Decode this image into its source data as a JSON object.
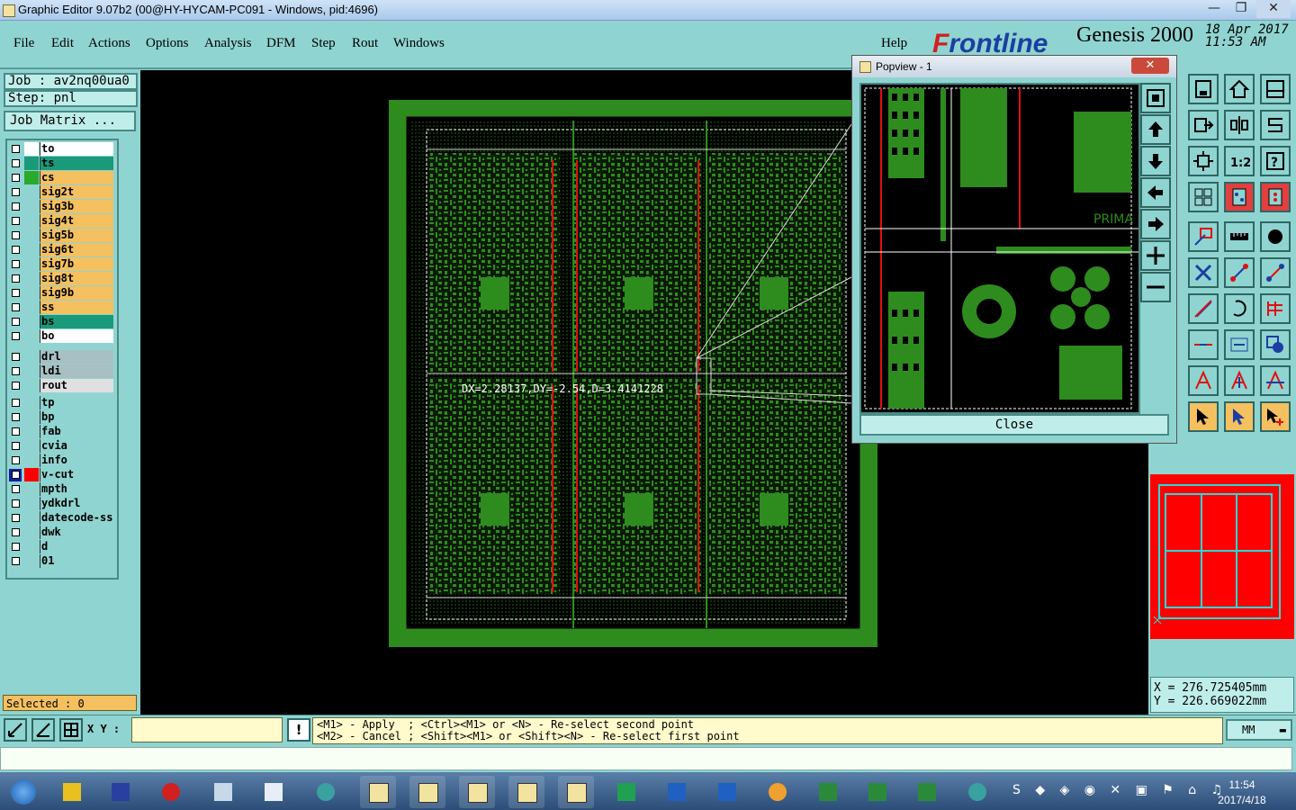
{
  "window": {
    "title": "Graphic Editor 9.07b2 (00@HY-HYCAM-PC091 - Windows, pid:4696)",
    "min_glyph": "—",
    "max_glyph": "❐",
    "close_glyph": "✕"
  },
  "menu": [
    {
      "label": "File"
    },
    {
      "label": "Edit"
    },
    {
      "label": "Actions"
    },
    {
      "label": "Options"
    },
    {
      "label": "Analysis"
    },
    {
      "label": "DFM"
    },
    {
      "label": "Step"
    },
    {
      "label": "Rout"
    },
    {
      "label": "Windows"
    }
  ],
  "help_label": "Help",
  "brand": {
    "logo_f": "F",
    "logo_rest": "rontline",
    "product": "Genesis 2000",
    "date": "18 Apr 2017",
    "time": "11:53 AM"
  },
  "job": {
    "job_label": "Job : av2nq00ua0",
    "step_label": "Step: pnl",
    "matrix_button": "Job Matrix ..."
  },
  "layers": [
    {
      "name": "to",
      "color": "#ffffff",
      "swatch": "#ffffff"
    },
    {
      "name": "ts",
      "color": "#1a9a7a",
      "swatch": "#1a9a7a"
    },
    {
      "name": "cs",
      "color": "#f4c060",
      "swatch": "#2aaa2a"
    },
    {
      "name": "sig2t",
      "color": "#f4c060",
      "swatch": "#8fd4d0"
    },
    {
      "name": "sig3b",
      "color": "#f4c060",
      "swatch": "#8fd4d0"
    },
    {
      "name": "sig4t",
      "color": "#f4c060",
      "swatch": "#8fd4d0"
    },
    {
      "name": "sig5b",
      "color": "#f4c060",
      "swatch": "#8fd4d0"
    },
    {
      "name": "sig6t",
      "color": "#f4c060",
      "swatch": "#8fd4d0"
    },
    {
      "name": "sig7b",
      "color": "#f4c060",
      "swatch": "#8fd4d0"
    },
    {
      "name": "sig8t",
      "color": "#f4c060",
      "swatch": "#8fd4d0"
    },
    {
      "name": "sig9b",
      "color": "#f4c060",
      "swatch": "#8fd4d0"
    },
    {
      "name": "ss",
      "color": "#f4c060",
      "swatch": "#8fd4d0"
    },
    {
      "name": "bs",
      "color": "#1a9a7a",
      "swatch": "#8fd4d0"
    },
    {
      "name": "bo",
      "color": "#ffffff",
      "swatch": "#8fd4d0"
    },
    {
      "name": "drl",
      "color": "#a8c0c4",
      "swatch": "#8fd4d0"
    },
    {
      "name": "ldi",
      "color": "#a8c0c4",
      "swatch": "#8fd4d0"
    },
    {
      "name": "rout",
      "color": "#e0e0e0",
      "swatch": "#8fd4d0"
    },
    {
      "name": "tp",
      "color": "#8fd4d0",
      "swatch": "#8fd4d0"
    },
    {
      "name": "bp",
      "color": "#8fd4d0",
      "swatch": "#8fd4d0"
    },
    {
      "name": "fab",
      "color": "#8fd4d0",
      "swatch": "#8fd4d0"
    },
    {
      "name": "cvia",
      "color": "#8fd4d0",
      "swatch": "#8fd4d0"
    },
    {
      "name": "info",
      "color": "#8fd4d0",
      "swatch": "#8fd4d0"
    },
    {
      "name": "v-cut",
      "color": "#8fd4d0",
      "swatch": "#ff0000",
      "active": true
    },
    {
      "name": "mpth",
      "color": "#8fd4d0",
      "swatch": "#8fd4d0"
    },
    {
      "name": "ydkdrl",
      "color": "#8fd4d0",
      "swatch": "#8fd4d0"
    },
    {
      "name": "datecode-ss",
      "color": "#8fd4d0",
      "swatch": "#8fd4d0"
    },
    {
      "name": "dwk",
      "color": "#8fd4d0",
      "swatch": "#8fd4d0"
    },
    {
      "name": "d",
      "color": "#8fd4d0",
      "swatch": "#8fd4d0"
    },
    {
      "name": "01",
      "color": "#8fd4d0",
      "swatch": "#8fd4d0"
    }
  ],
  "selected_label": "Selected : 0",
  "measure_text": "DX=2.28137,DY=-2.54,D=3.4141228",
  "popview": {
    "title": "Popview - 1",
    "close_label": "Close",
    "silk_text": "PRIMA"
  },
  "coords": {
    "x": "X  =  276.725405mm",
    "y": "Y  =  226.669022mm"
  },
  "xy_label": "X Y :",
  "xy_value": "",
  "hint_lines": "<M1> - Apply  ; <Ctrl><M1> or <N> - Re-select second point\n<M2> - Cancel ; <Shift><M1> or <Shift><N> - Re-select first point",
  "units_value": "MM",
  "taskbar": {
    "clock_time": "11:54",
    "clock_date": "2017/4/18"
  },
  "colors": {
    "panel": "#8fd4d0",
    "board_green": "#2e8b1e",
    "accent_red": "#ff0000"
  }
}
